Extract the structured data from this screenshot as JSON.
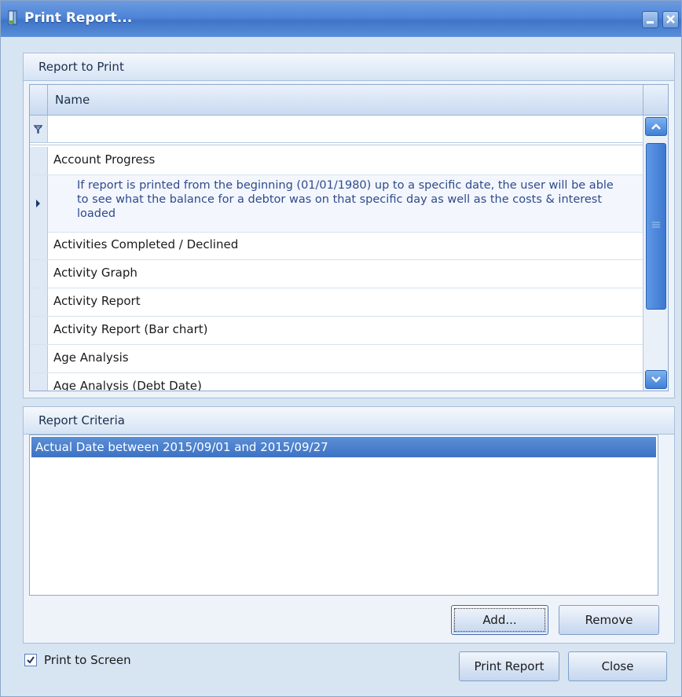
{
  "window": {
    "title": "Print Report..."
  },
  "report_group": {
    "title": "Report to Print",
    "column_header": "Name",
    "filter_value": "",
    "rows": [
      {
        "label": "Account Progress"
      },
      {
        "label": "",
        "description": "If report is printed from the beginning (01/01/1980)  up to a specific date, the user will be able to see what the balance for a debtor was on that specific day as well as the costs & interest loaded"
      },
      {
        "label": "Activities Completed / Declined"
      },
      {
        "label": "Activity Graph"
      },
      {
        "label": "Activity Report"
      },
      {
        "label": "Activity Report (Bar chart)"
      },
      {
        "label": "Age Analysis"
      },
      {
        "label": "Age Analysis (Debt Date)"
      }
    ]
  },
  "criteria_group": {
    "title": "Report Criteria",
    "items": [
      "Actual Date between 2015/09/01 and 2015/09/27"
    ]
  },
  "buttons": {
    "add": "Add...",
    "remove": "Remove",
    "print_report": "Print Report",
    "close": "Close"
  },
  "options": {
    "print_to_screen_label": "Print to Screen",
    "print_to_screen_checked": true
  },
  "colors": {
    "titlebar": "#4f85d6",
    "selection": "#3d72c4",
    "description_text": "#2f4a8c"
  }
}
